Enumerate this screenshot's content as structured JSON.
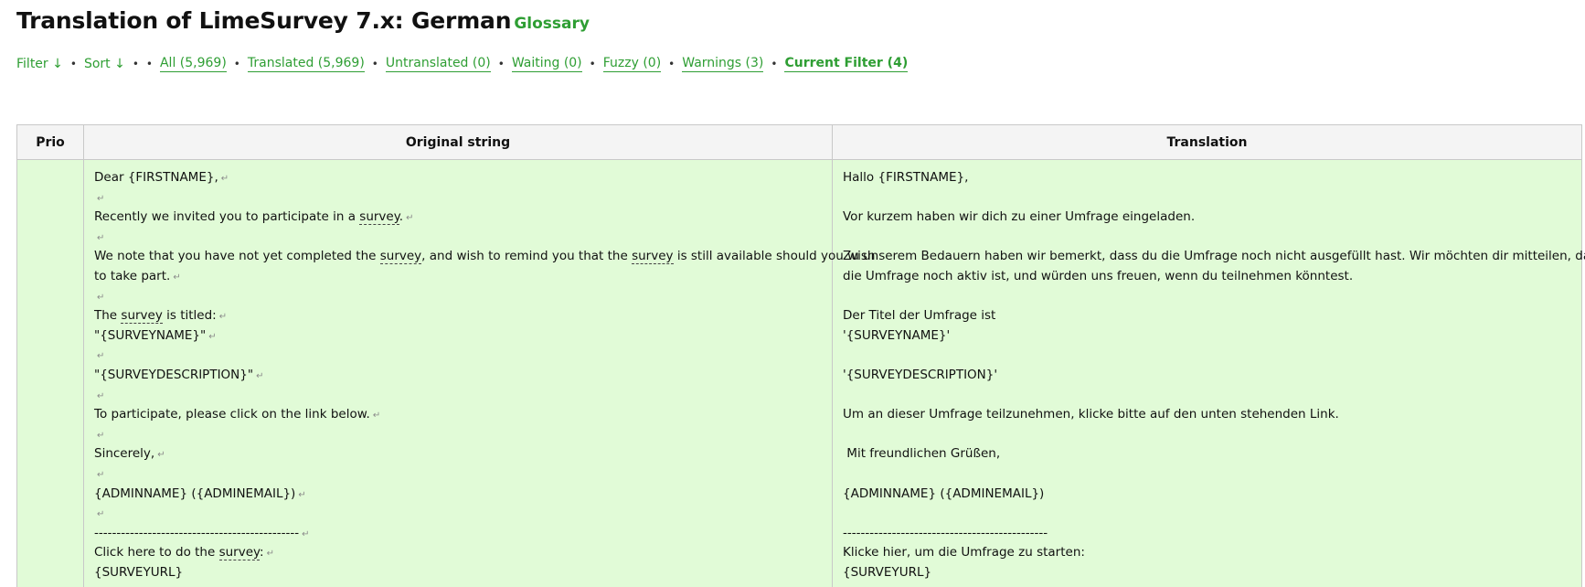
{
  "header": {
    "title": "Translation of LimeSurvey 7.x: German",
    "glossary_label": "Glossary"
  },
  "filter_bar": {
    "filter_label": "Filter ↓",
    "sort_label": "Sort ↓",
    "all": "All (5,969)",
    "translated": "Translated (5,969)",
    "untranslated": "Untranslated (0)",
    "waiting": "Waiting (0)",
    "fuzzy": "Fuzzy (0)",
    "warnings": "Warnings (3)",
    "current_filter": "Current Filter (4)",
    "separator": "•"
  },
  "table": {
    "headers": {
      "prio": "Prio",
      "original": "Original string",
      "translation": "Translation"
    },
    "newline_symbol": "↵",
    "glossary_term": "survey",
    "row": {
      "prio": "",
      "original": {
        "l1": "Dear {FIRSTNAME},",
        "l3a": "Recently we invited you to participate in a ",
        "l3b": ".",
        "l5a": "We note that you have not yet completed the ",
        "l5b": ", and wish to remind you that the ",
        "l5c": " is still available should you wish",
        "l6": "to take part.",
        "l8a": "The ",
        "l8b": " is titled:",
        "l9": "\"{SURVEYNAME}\"",
        "l11": "\"{SURVEYDESCRIPTION}\"",
        "l13": "To participate, please click on the link below.",
        "l15": "Sincerely,",
        "l17": "{ADMINNAME} ({ADMINEMAIL})",
        "l19": "----------------------------------------------",
        "l20a": "Click here to do the ",
        "l20b": ":",
        "l21": "{SURVEYURL}"
      },
      "translation": {
        "l1": "Hallo {FIRSTNAME},",
        "l3": "Vor kurzem haben wir dich zu einer Umfrage eingeladen.",
        "l5": "Zu unserem Bedauern haben wir bemerkt, dass du die Umfrage noch nicht ausgefüllt hast. Wir möchten dir mitteilen, dass",
        "l6": "die Umfrage noch aktiv ist, und würden uns freuen, wenn du teilnehmen könntest.",
        "l8": "Der Titel der Umfrage ist",
        "l9": "'{SURVEYNAME}'",
        "l11": "'{SURVEYDESCRIPTION}'",
        "l13": "Um an dieser Umfrage teilzunehmen, klicke bitte auf den unten stehenden Link.",
        "l15": " Mit freundlichen Grüßen,",
        "l17": "{ADMINNAME} ({ADMINEMAIL})",
        "l19": "----------------------------------------------",
        "l20": "Klicke hier, um die Umfrage zu starten:",
        "l21": "{SURVEYURL}"
      }
    }
  },
  "colors": {
    "accent_green": "#2e9e33",
    "row_background": "#e1fbd7",
    "header_background": "#f4f4f4"
  }
}
